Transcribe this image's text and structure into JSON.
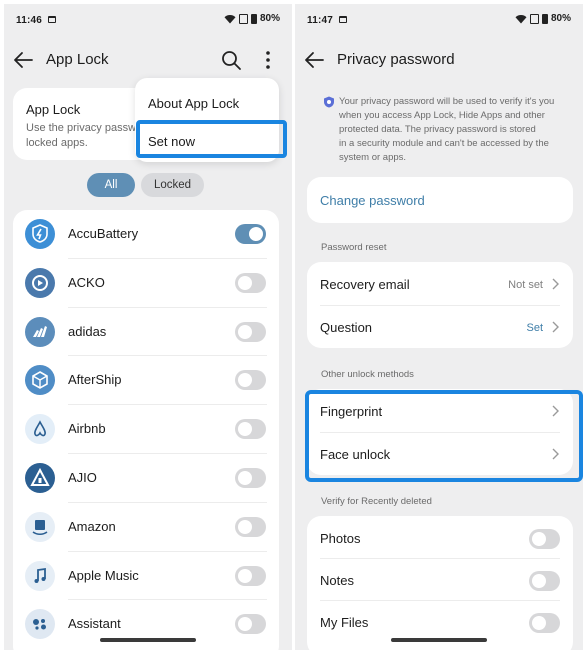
{
  "left": {
    "status": {
      "time": "11:46",
      "battery": "80%"
    },
    "header": {
      "title": "App Lock"
    },
    "info": {
      "title": "App Lock",
      "desc": "Use the privacy passw\nlocked apps."
    },
    "menu": {
      "items": [
        "About App Lock",
        "Set now"
      ]
    },
    "filters": {
      "all": "All",
      "locked": "Locked"
    },
    "apps": [
      {
        "name": "AccuBattery",
        "on": true,
        "icon": "accubattery-icon",
        "color": "#3d8fd6"
      },
      {
        "name": "ACKO",
        "on": false,
        "icon": "acko-icon",
        "color": "#4a79ac"
      },
      {
        "name": "adidas",
        "on": false,
        "icon": "adidas-icon",
        "color": "#5c8dbb"
      },
      {
        "name": "AfterShip",
        "on": false,
        "icon": "aftership-icon",
        "color": "#4f8dc6"
      },
      {
        "name": "Airbnb",
        "on": false,
        "icon": "airbnb-icon",
        "color": "#e3eef8"
      },
      {
        "name": "AJIO",
        "on": false,
        "icon": "ajio-icon",
        "color": "#2b5f92"
      },
      {
        "name": "Amazon",
        "on": false,
        "icon": "amazon-icon",
        "color": "#e6eef6"
      },
      {
        "name": "Apple Music",
        "on": false,
        "icon": "apple-music-icon",
        "color": "#e6eef6"
      },
      {
        "name": "Assistant",
        "on": false,
        "icon": "assistant-icon",
        "color": "#dfe8f2"
      }
    ]
  },
  "right": {
    "status": {
      "time": "11:47",
      "battery": "80%"
    },
    "header": {
      "title": "Privacy password"
    },
    "notice": "Your privacy password will be used to verify it's you\nwhen you access App Lock, Hide Apps and other\nprotected data. The privacy password is stored\nin a security module and can't be accessed by the\nsystem or apps.",
    "change_password": "Change password",
    "reset": {
      "label": "Password reset",
      "rows": [
        {
          "label": "Recovery email",
          "value": "Not set"
        },
        {
          "label": "Question",
          "value": "Set"
        }
      ]
    },
    "other": {
      "label": "Other unlock methods",
      "rows": [
        {
          "label": "Fingerprint"
        },
        {
          "label": "Face unlock"
        }
      ]
    },
    "verify": {
      "label": "Verify for Recently deleted",
      "rows": [
        {
          "label": "Photos",
          "on": false
        },
        {
          "label": "Notes",
          "on": false
        },
        {
          "label": "My Files",
          "on": false
        }
      ]
    }
  },
  "colors": {
    "accent": "#5f8fb5",
    "link": "#3f7ea8",
    "highlight": "#1a85e0",
    "background": "#eeeeef"
  }
}
